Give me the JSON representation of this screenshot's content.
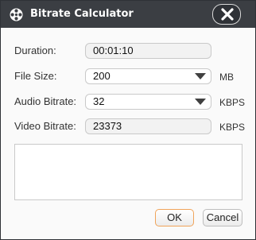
{
  "window": {
    "title": "Bitrate Calculator",
    "app_icon": "film-reel-icon",
    "close_icon": "close-icon"
  },
  "form": {
    "duration": {
      "label": "Duration:",
      "value": "00:01:10"
    },
    "file_size": {
      "label": "File Size:",
      "value": "200",
      "unit": "MB"
    },
    "audio_bitrate": {
      "label": "Audio Bitrate:",
      "value": "32",
      "unit": "KBPS"
    },
    "video_bitrate": {
      "label": "Video Bitrate:",
      "value": "23373",
      "unit": "KBPS"
    }
  },
  "info_box": {
    "text": ""
  },
  "buttons": {
    "ok": "OK",
    "cancel": "Cancel"
  },
  "colors": {
    "titlebar": "#3b3e43",
    "ok_border": "#f0a45a",
    "background": "#fafafa"
  }
}
